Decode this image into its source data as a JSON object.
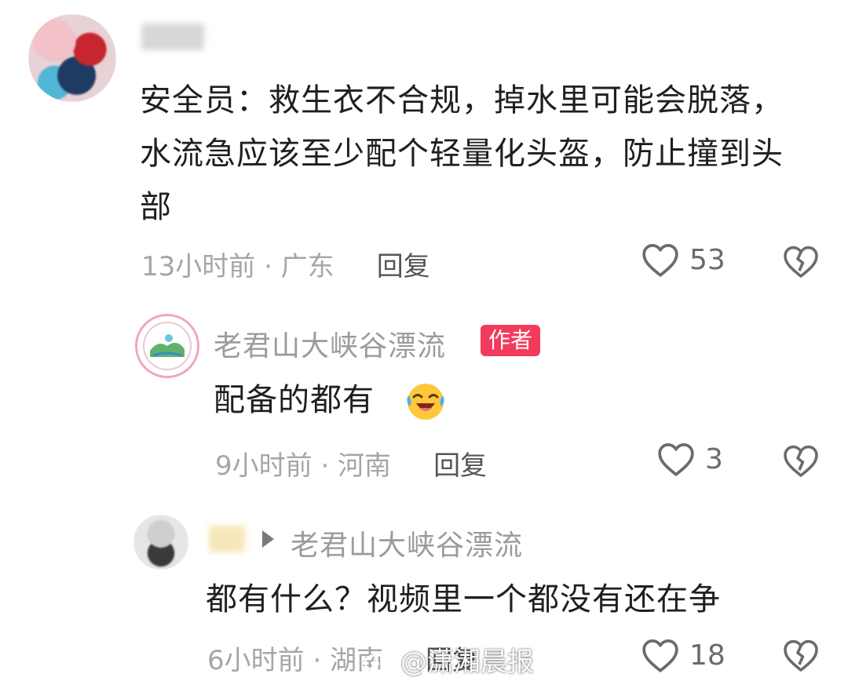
{
  "comments": [
    {
      "text": "安全员：救生衣不合规，掉水里可能会脱落，水流急应该至少配个轻量化头盔，防止撞到头部",
      "time_location": "13小时前 · 广东",
      "reply_label": "回复",
      "likes": "53"
    },
    {
      "username": "老君山大峡谷漂流",
      "badge": "作者",
      "text": "配备的都有",
      "time_location": "9小时前 · 河南",
      "reply_label": "回复",
      "likes": "3"
    },
    {
      "reply_to": "老君山大峡谷漂流",
      "text": "都有什么？视频里一个都没有还在争",
      "time_location": "6小时前 · 湖南",
      "reply_label": "回复",
      "likes": "18"
    }
  ],
  "watermark": "@潇湘晨报",
  "icons": {
    "like": "heart-outline-icon",
    "dislike": "broken-heart-icon",
    "emoji": "laughing-tears-emoji-icon",
    "reply_arrow": "triangle-right-icon",
    "watermark_logo": "weibo-icon"
  },
  "colors": {
    "badge": "#f23a5c",
    "meta_text": "#a6a6a6",
    "author_name": "#9b9b9b"
  }
}
